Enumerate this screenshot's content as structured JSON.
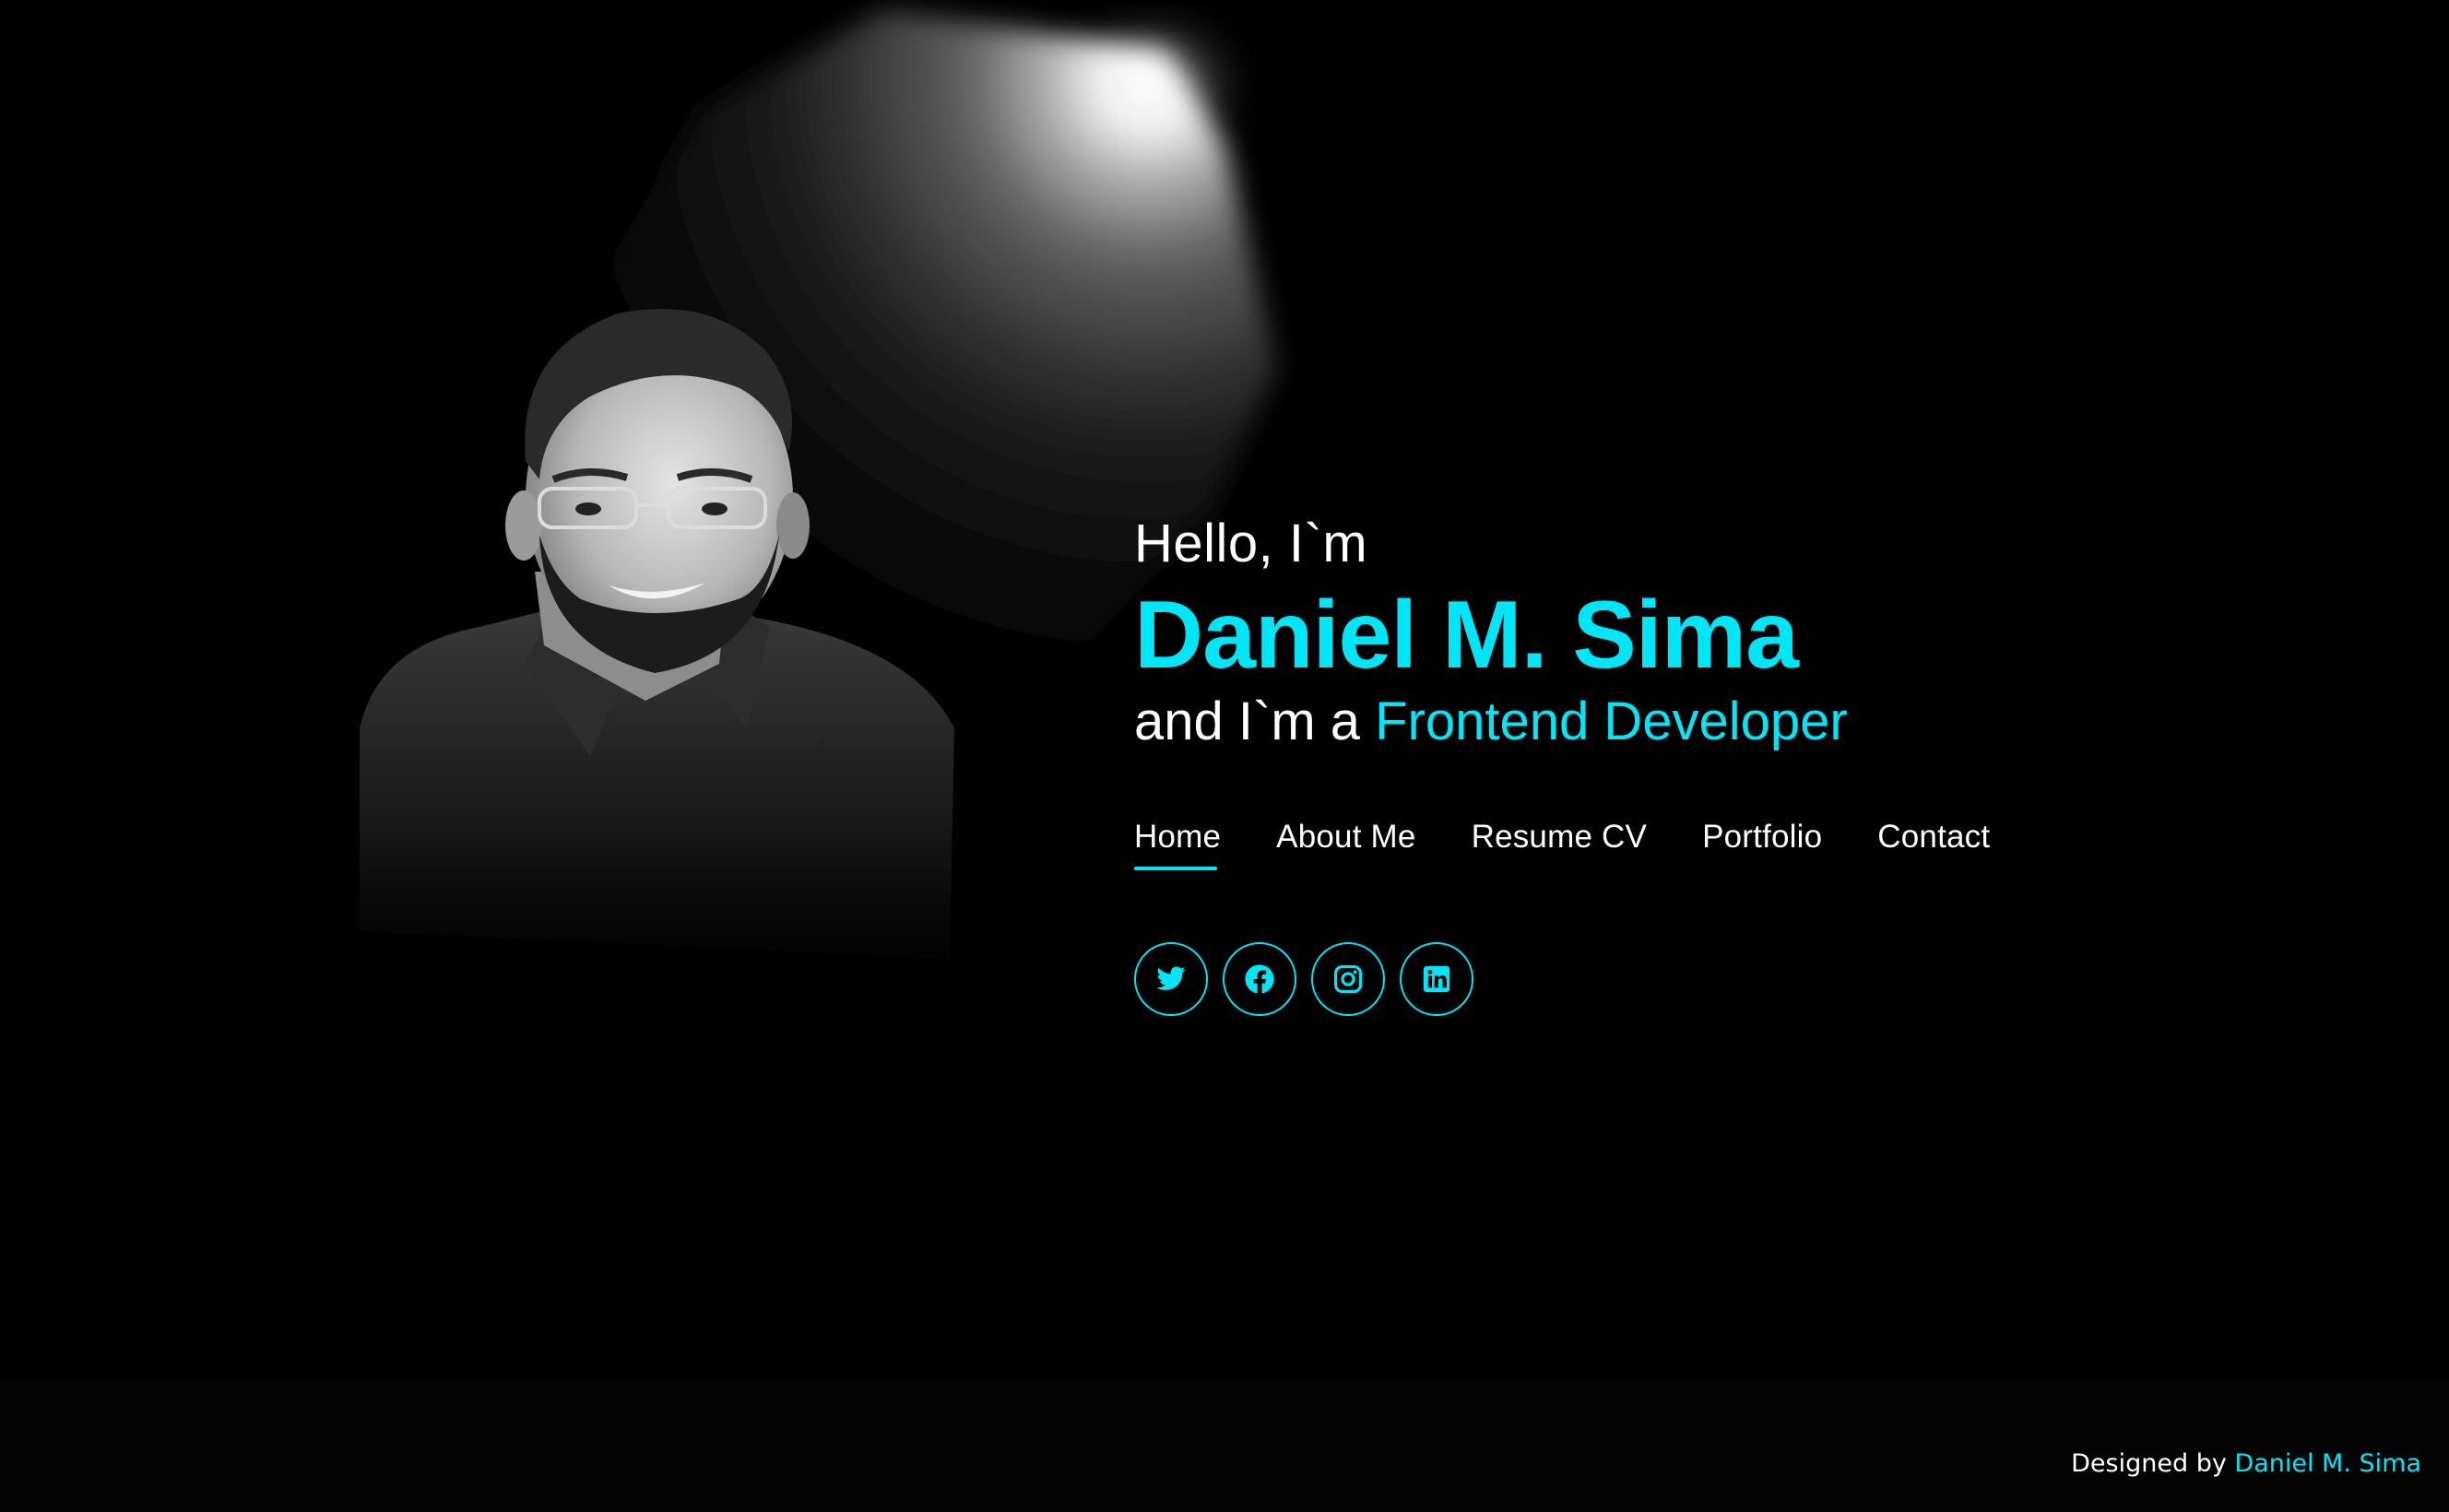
{
  "hero": {
    "greeting": "Hello, I`m",
    "name": "Daniel M. Sima",
    "role_prefix": "and I`m a ",
    "role": "Frontend Developer"
  },
  "nav": {
    "items": [
      {
        "label": "Home",
        "active": true
      },
      {
        "label": "About Me",
        "active": false
      },
      {
        "label": "Resume CV",
        "active": false
      },
      {
        "label": "Portfolio",
        "active": false
      },
      {
        "label": "Contact",
        "active": false
      }
    ]
  },
  "socials": [
    {
      "icon": "twitter-icon"
    },
    {
      "icon": "facebook-icon"
    },
    {
      "icon": "instagram-icon"
    },
    {
      "icon": "linkedin-icon"
    }
  ],
  "footer": {
    "credit_prefix": "Designed by ",
    "credit_author": "Daniel M. Sima"
  },
  "colors": {
    "accent": "#00e6f7",
    "background": "#000000",
    "text": "#ffffff"
  }
}
